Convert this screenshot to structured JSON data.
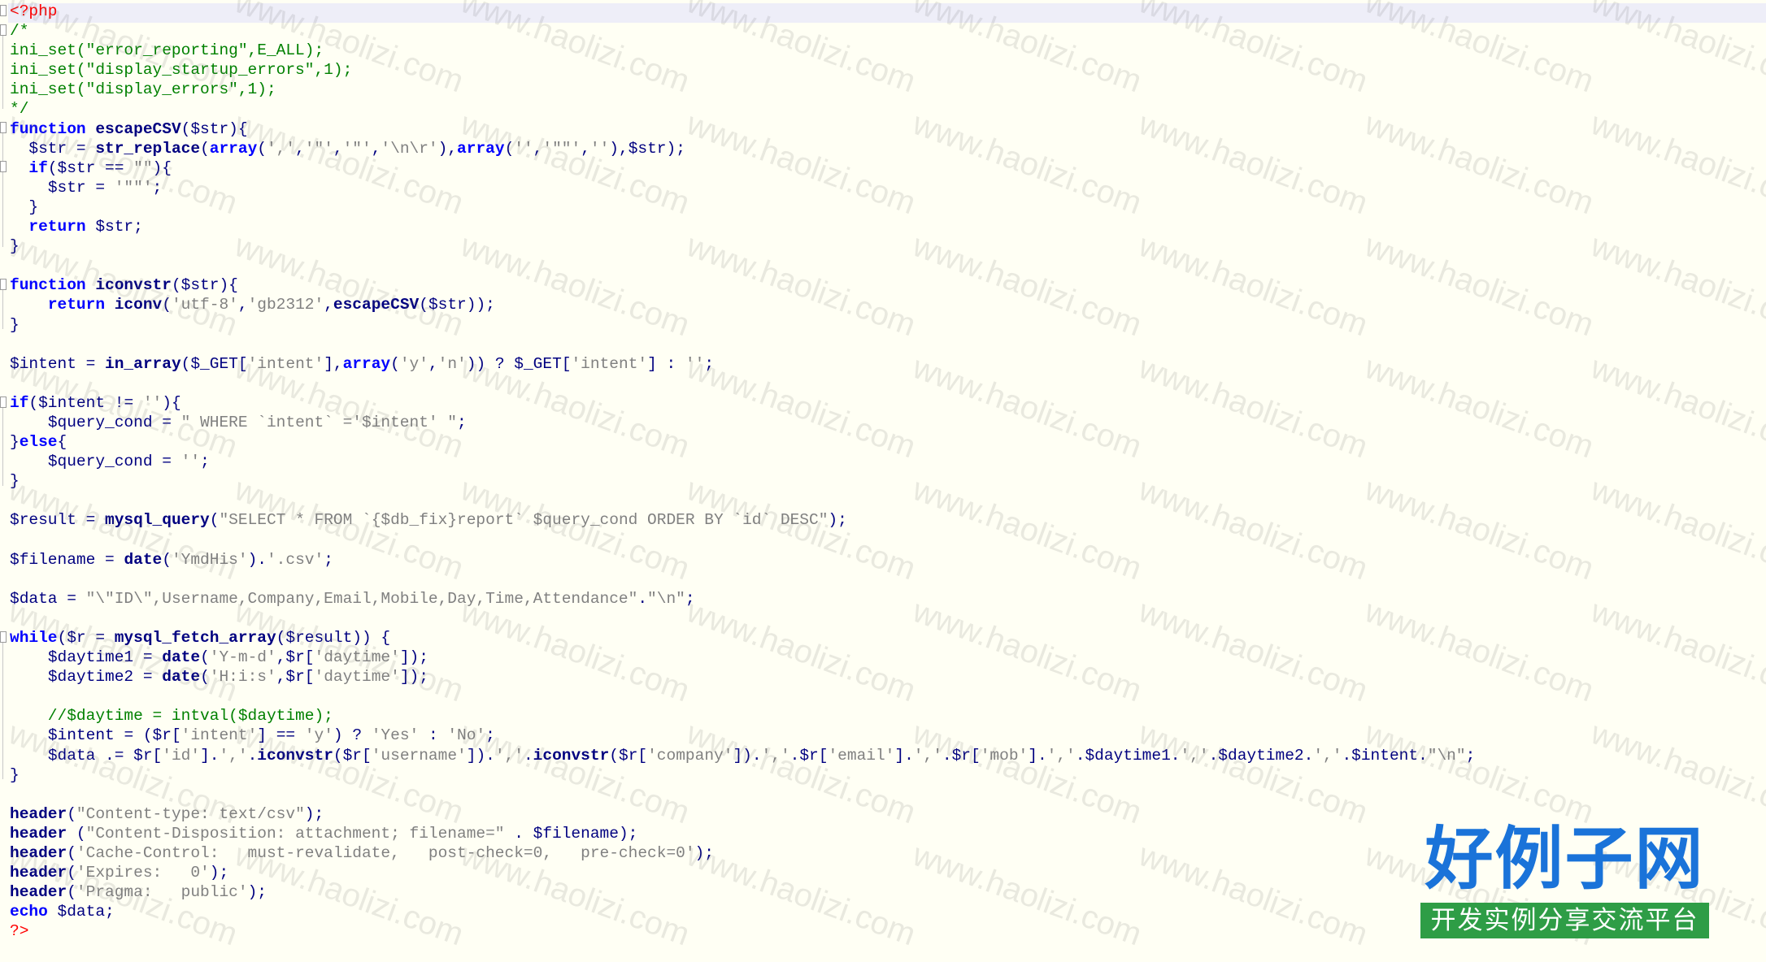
{
  "editor": {
    "background": "#fffff4",
    "lines": [
      "<?php",
      "/*",
      "ini_set(\"error_reporting\",E_ALL);",
      "ini_set(\"display_startup_errors\",1);",
      "ini_set(\"display_errors\",1);",
      "*/",
      "function escapeCSV($str){",
      "  $str = str_replace(array(',','\"','\"','\\n\\r'),array('','\"\"',''),$str);",
      "  if($str == \"\"){",
      "    $str = '\"\"';",
      "  }",
      "  return $str;",
      "}",
      "",
      "function iconvstr($str){",
      "    return iconv('utf-8','gb2312',escapeCSV($str));",
      "}",
      "",
      "$intent = in_array($_GET['intent'],array('y','n')) ? $_GET['intent'] : '';",
      "",
      "if($intent != ''){",
      "    $query_cond = \" WHERE `intent` ='$intent' \";",
      "}else{",
      "    $query_cond = '';",
      "}",
      "",
      "$result = mysql_query(\"SELECT * FROM `{$db_fix}report` $query_cond ORDER BY `id` DESC\");",
      "",
      "$filename = date('YmdHis').'.csv';",
      "",
      "$data = \"\\\"ID\\\",Username,Company,Email,Mobile,Day,Time,Attendance\".\"\\n\";",
      "",
      "while($r = mysql_fetch_array($result)) {",
      "    $daytime1 = date('Y-m-d',$r['daytime']);",
      "    $daytime2 = date('H:i:s',$r['daytime']);",
      "",
      "    //$daytime = intval($daytime);",
      "    $intent = ($r['intent'] == 'y') ? 'Yes' : 'No';",
      "    $data .= $r['id'].','.iconvstr($r['username']).','.iconvstr($r['company']).','.$r['email'].','.$r['mob'].','.$daytime1.','.$daytime2.','.$intent.\"\\n\";",
      "}",
      "",
      "header(\"Content-type: text/csv\");",
      "header (\"Content-Disposition: attachment; filename=\" . $filename);",
      "header('Cache-Control:   must-revalidate,   post-check=0,   pre-check=0');",
      "header('Expires:   0');",
      "header('Pragma:   public');",
      "echo $data;",
      "?>"
    ]
  },
  "watermark": {
    "text": "www.haolizi.com"
  },
  "brand": {
    "title": "好例子网",
    "subtitle": "开发实例分享交流平台",
    "title_color": "#1a73d9",
    "subtitle_bg": "#2e9d46"
  }
}
